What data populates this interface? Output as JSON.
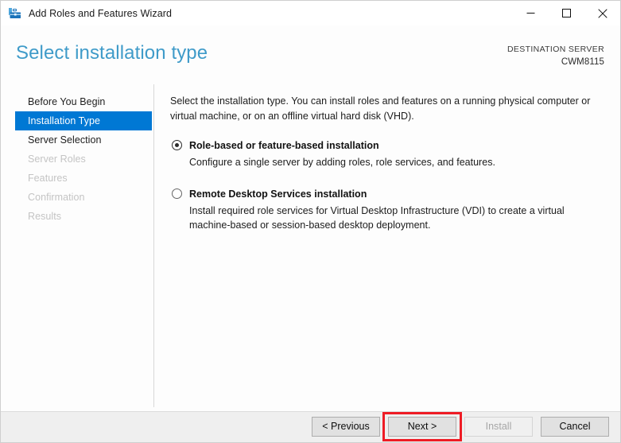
{
  "window": {
    "title": "Add Roles and Features Wizard",
    "icon": "server-manager-toolbox-icon",
    "controls": {
      "minimize": "minimize-icon",
      "maximize": "maximize-icon",
      "close": "close-icon"
    }
  },
  "header": {
    "page_title": "Select installation type",
    "destination_server_label": "DESTINATION SERVER",
    "destination_server_value": "CWM8115",
    "title_color": "#3f9bc9"
  },
  "sidebar": {
    "items": [
      {
        "label": "Before You Begin",
        "state": "enabled"
      },
      {
        "label": "Installation Type",
        "state": "selected"
      },
      {
        "label": "Server Selection",
        "state": "enabled"
      },
      {
        "label": "Server Roles",
        "state": "disabled"
      },
      {
        "label": "Features",
        "state": "disabled"
      },
      {
        "label": "Confirmation",
        "state": "disabled"
      },
      {
        "label": "Results",
        "state": "disabled"
      }
    ],
    "selected_color": "#0078d4"
  },
  "main": {
    "intro": "Select the installation type. You can install roles and features on a running physical computer or virtual machine, or on an offline virtual hard disk (VHD).",
    "options": [
      {
        "label": "Role-based or feature-based installation",
        "description": "Configure a single server by adding roles, role services, and features.",
        "selected": true
      },
      {
        "label": "Remote Desktop Services installation",
        "description": "Install required role services for Virtual Desktop Infrastructure (VDI) to create a virtual machine-based or session-based desktop deployment.",
        "selected": false
      }
    ]
  },
  "footer": {
    "buttons": [
      {
        "label": "< Previous",
        "state": "enabled",
        "highlighted": false
      },
      {
        "label": "Next >",
        "state": "enabled",
        "highlighted": true
      },
      {
        "label": "Install",
        "state": "disabled",
        "highlighted": false
      },
      {
        "label": "Cancel",
        "state": "enabled",
        "highlighted": false
      }
    ],
    "highlight_color": "#ee1c25"
  }
}
